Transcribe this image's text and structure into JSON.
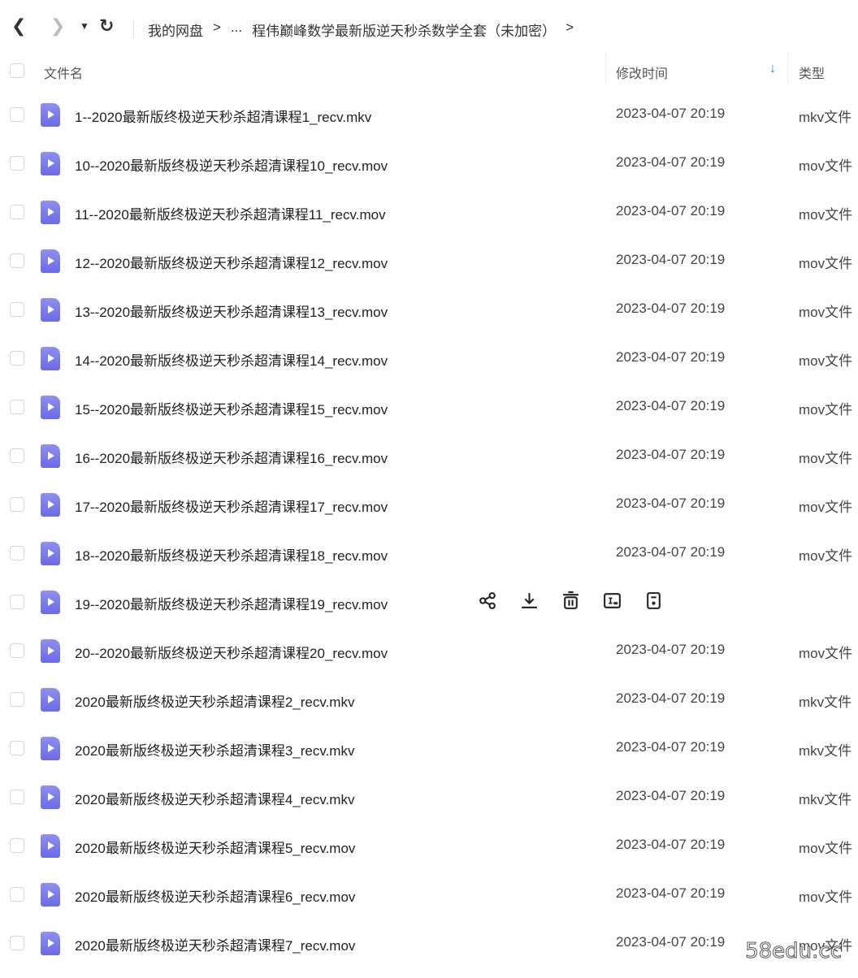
{
  "toolbar": {
    "back_icon": "chevron-left",
    "forward_icon": "chevron-right",
    "dropdown_icon": "caret-down",
    "refresh_icon": "refresh",
    "breadcrumb": [
      "我的网盘",
      ">",
      "...",
      "程伟巅峰数学最新版逆天秒杀数学全套（未加密）",
      ">"
    ]
  },
  "header": {
    "name": "文件名",
    "modified": "修改时间",
    "type": "类型",
    "sort_icon": "arrow-down",
    "sort_color": "#1a7cf5"
  },
  "files": [
    {
      "name": "1--2020最新版终极逆天秒杀超清课程1_recv.mkv",
      "date": "2023-04-07 20:19",
      "type": "mkv文件"
    },
    {
      "name": "10--2020最新版终极逆天秒杀超清课程10_recv.mov",
      "date": "2023-04-07 20:19",
      "type": "mov文件"
    },
    {
      "name": "11--2020最新版终极逆天秒杀超清课程11_recv.mov",
      "date": "2023-04-07 20:19",
      "type": "mov文件"
    },
    {
      "name": "12--2020最新版终极逆天秒杀超清课程12_recv.mov",
      "date": "2023-04-07 20:19",
      "type": "mov文件"
    },
    {
      "name": "13--2020最新版终极逆天秒杀超清课程13_recv.mov",
      "date": "2023-04-07 20:19",
      "type": "mov文件"
    },
    {
      "name": "14--2020最新版终极逆天秒杀超清课程14_recv.mov",
      "date": "2023-04-07 20:19",
      "type": "mov文件"
    },
    {
      "name": "15--2020最新版终极逆天秒杀超清课程15_recv.mov",
      "date": "2023-04-07 20:19",
      "type": "mov文件"
    },
    {
      "name": "16--2020最新版终极逆天秒杀超清课程16_recv.mov",
      "date": "2023-04-07 20:19",
      "type": "mov文件"
    },
    {
      "name": "17--2020最新版终极逆天秒杀超清课程17_recv.mov",
      "date": "2023-04-07 20:19",
      "type": "mov文件"
    },
    {
      "name": "18--2020最新版终极逆天秒杀超清课程18_recv.mov",
      "date": "2023-04-07 20:19",
      "type": "mov文件"
    },
    {
      "name": "19--2020最新版终极逆天秒杀超清课程19_recv.mov",
      "hover": true,
      "actions": [
        "share",
        "download",
        "delete",
        "rename",
        "more"
      ]
    },
    {
      "name": "20--2020最新版终极逆天秒杀超清课程20_recv.mov",
      "date": "2023-04-07 20:19",
      "type": "mov文件"
    },
    {
      "name": "2020最新版终极逆天秒杀超清课程2_recv.mkv",
      "date": "2023-04-07 20:19",
      "type": "mkv文件"
    },
    {
      "name": "2020最新版终极逆天秒杀超清课程3_recv.mkv",
      "date": "2023-04-07 20:19",
      "type": "mkv文件"
    },
    {
      "name": "2020最新版终极逆天秒杀超清课程4_recv.mkv",
      "date": "2023-04-07 20:19",
      "type": "mkv文件"
    },
    {
      "name": "2020最新版终极逆天秒杀超清课程5_recv.mov",
      "date": "2023-04-07 20:19",
      "type": "mov文件"
    },
    {
      "name": "2020最新版终极逆天秒杀超清课程6_recv.mov",
      "date": "2023-04-07 20:19",
      "type": "mov文件"
    },
    {
      "name": "2020最新版终极逆天秒杀超清课程7_recv.mov",
      "date": "2023-04-07 20:19",
      "type": "mov文件"
    }
  ],
  "watermark": "58edu.cc"
}
